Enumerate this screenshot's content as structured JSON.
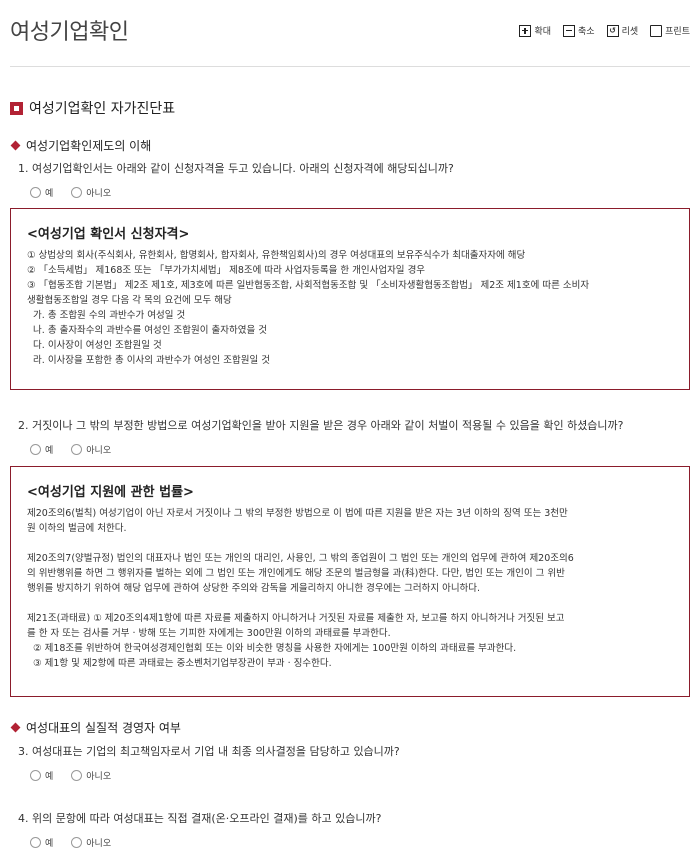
{
  "page_title": "여성기업확인",
  "toolbar": {
    "zoom_in": "확대",
    "zoom_out": "축소",
    "reset": "리셋",
    "print": "프린트"
  },
  "section_title": "여성기업확인 자가진단표",
  "group1_title": "여성기업확인제도의 이해",
  "group2_title": "여성대표의 실질적 경영자 여부",
  "radio_yes": "예",
  "radio_no": "아니오",
  "questions": {
    "q1": "1. 여성기업확인서는 아래와 같이 신청자격을 두고 있습니다. 아래의 신청자격에 해당되십니까?",
    "q2": "2. 거짓이나 그 밖의 부정한 방법으로 여성기업확인을 받아 지원을 받은 경우 아래와 같이 처벌이 적용될 수 있음을 확인 하셨습니까?",
    "q3": "3. 여성대표는 기업의 최고책임자로서 기업 내 최종 의사결정을 담당하고 있습니까?",
    "q4": "4. 위의 문항에 따라 여성대표는 직접 결재(온·오프라인 결재)를 하고 있습니까?"
  },
  "box1": {
    "title": "<여성기업 확인서 신청자격>",
    "lines": [
      "① 상법상의 회사(주식회사, 유한회사, 합명회사, 합자회사, 유한책임회사)의 경우 여성대표의 보유주식수가 최대출자자에 해당",
      "② 「소득세법」 제168조 또는 「부가가치세법」 제8조에 따라 사업자등록을 한 개인사업자일 경우",
      "③ 「협동조합 기본법」 제2조 제1호, 제3호에 따른 일반협동조합, 사회적협동조합 및 「소비자생활협동조합법」 제2조 제1호에 따른 소비자",
      "생활협동조합일 경우 다음 각 목의 요건에 모두 해당",
      "  가. 총 조합원 수의 과반수가 여성일 것",
      "  나. 총 출자좌수의 과반수를 여성인 조합원이 출자하였을 것",
      "  다. 이사장이 여성인 조합원일 것",
      "  라. 이사장을 포함한 총 이사의 과반수가 여성인 조합원일 것"
    ]
  },
  "box2": {
    "title": "<여성기업 지원에 관한 법률>",
    "para1": [
      "제20조의6(벌칙) 여성기업이 아닌 자로서 거짓이나 그 밖의 부정한 방법으로 이 법에 따른 지원을 받은 자는 3년 이하의 징역 또는 3천만",
      "원 이하의 벌금에 처한다."
    ],
    "para2": [
      "제20조의7(양벌규정) 법인의 대표자나 법인 또는 개인의 대리인, 사용인, 그 밖의 종업원이 그 법인 또는 개인의 업무에 관하여 제20조의6",
      "의 위반행위를 하면 그 행위자를 벌하는 외에 그 법인 또는 개인에게도 해당 조문의 벌금형을 과(科)한다. 다만, 법인 또는 개인이 그 위반",
      "행위를 방지하기 위하여 해당 업무에 관하여 상당한 주의와 감독을 게을리하지 아니한 경우에는 그러하지 아니하다."
    ],
    "para3": [
      "제21조(과태료) ① 제20조의4제1항에 따른 자료를 제출하지 아니하거나 거짓된 자료를 제출한 자, 보고를 하지 아니하거나 거짓된 보고",
      "를 한 자 또는 검사를 거부 · 방해 또는 기피한 자에게는 300만원 이하의 과태료를 부과한다.",
      "  ② 제18조를 위반하여 한국여성경제인협회 또는 이와 비슷한 명칭을 사용한 자에게는 100만원 이하의 과태료를 부과한다.",
      "  ③ 제1항 및 제2항에 따른 과태료는 중소벤처기업부장관이 부과 · 징수한다."
    ]
  }
}
